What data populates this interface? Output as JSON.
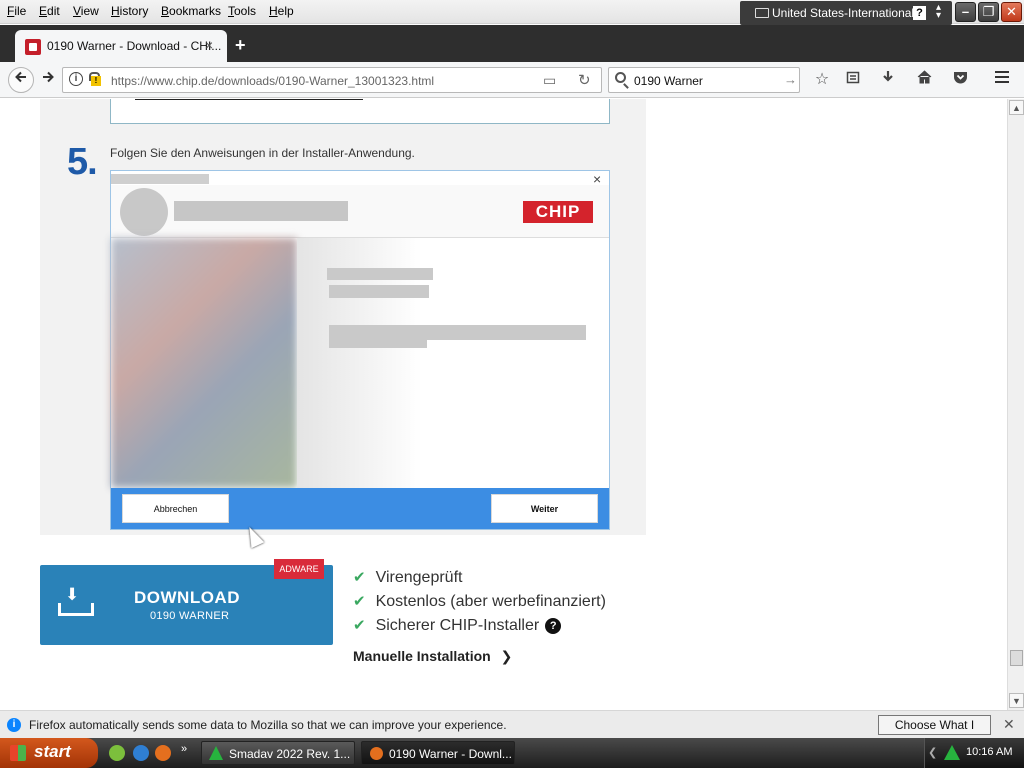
{
  "menubar": {
    "items": [
      {
        "label": "File",
        "ul": "F",
        "rest": "ile"
      },
      {
        "label": "Edit",
        "ul": "E",
        "rest": "dit"
      },
      {
        "label": "View",
        "ul": "V",
        "rest": "iew"
      },
      {
        "label": "History",
        "ul": "H",
        "rest": "istory"
      },
      {
        "label": "Bookmarks",
        "ul": "B",
        "rest": "ookmarks"
      },
      {
        "label": "Tools",
        "ul": "T",
        "rest": "ools"
      },
      {
        "label": "Help",
        "ul": "H",
        "rest": "elp"
      }
    ],
    "language": "United States-International",
    "help_glyph": "?"
  },
  "tab": {
    "title": "0190 Warner - Download - CHI...",
    "close": "×",
    "new_tab": "+"
  },
  "navbar": {
    "url": "https://www.chip.de/downloads/0190-Warner_13001323.html",
    "search_query": "0190 Warner"
  },
  "page": {
    "step_number": "5.",
    "step_text": "Folgen Sie den Anweisungen in der Installer-Anwendung.",
    "installer": {
      "logo": "CHIP",
      "close": "×",
      "cancel_label": "Abbrechen",
      "next_label": "Weiter"
    },
    "download": {
      "title": "DOWNLOAD",
      "subtitle": "0190 WARNER",
      "badge": "ADWARE"
    },
    "features": [
      "Virengeprüft",
      "Kostenlos (aber werbefinanziert)",
      "Sicherer CHIP-Installer"
    ],
    "manual_link": "Manuelle Installation"
  },
  "notification": {
    "message": "Firefox automatically sends some data to Mozilla so that we can improve your experience.",
    "button": "Choose What I Share"
  },
  "taskbar": {
    "start": "start",
    "tasks": [
      "Smadav 2022 Rev. 1...",
      "0190 Warner - Downl..."
    ],
    "clock": "10:16 AM"
  },
  "colors": {
    "chip_red": "#d4232c",
    "download_blue": "#2a82b8",
    "installer_blue": "#3c8de3",
    "check_green": "#3aa860",
    "step_blue": "#1e5aa8"
  }
}
